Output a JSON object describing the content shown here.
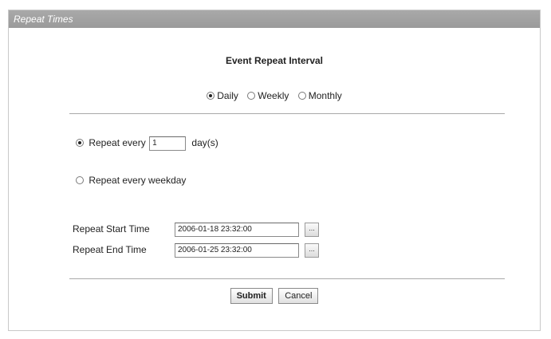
{
  "panel": {
    "title": "Repeat Times"
  },
  "interval": {
    "heading": "Event Repeat Interval",
    "options": [
      {
        "label": "Daily",
        "checked": true
      },
      {
        "label": "Weekly",
        "checked": false
      },
      {
        "label": "Monthly",
        "checked": false
      }
    ]
  },
  "daily": {
    "repeat_every_label": "Repeat every",
    "repeat_every_value": "1",
    "repeat_every_unit": "day(s)",
    "repeat_every_checked": true,
    "weekday_label": "Repeat every weekday",
    "weekday_checked": false
  },
  "times": {
    "start_label": "Repeat Start Time",
    "start_value": "2006-01-18 23:32:00",
    "end_label": "Repeat End Time",
    "end_value": "2006-01-25 23:32:00",
    "picker_label": "..."
  },
  "actions": {
    "submit_label": "Submit",
    "cancel_label": "Cancel"
  }
}
